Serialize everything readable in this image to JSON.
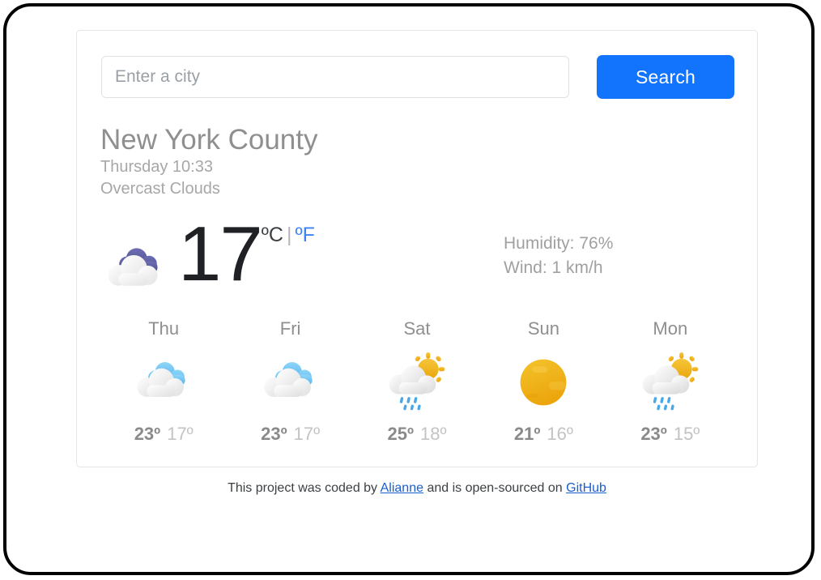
{
  "search": {
    "placeholder": "Enter a city",
    "value": "",
    "button_label": "Search"
  },
  "location": {
    "city": "New York County",
    "datetime": "Thursday 10:33",
    "condition": "Overcast Clouds"
  },
  "current": {
    "icon": "overcast-clouds-icon",
    "temperature": "17",
    "unit_celsius": "ºC",
    "unit_separator": "|",
    "unit_fahrenheit": "ºF",
    "humidity": "Humidity: 76%",
    "wind": "Wind: 1 km/h"
  },
  "forecast": [
    {
      "day": "Thu",
      "icon": "scattered-clouds-icon",
      "max": "23º",
      "min": "17º"
    },
    {
      "day": "Fri",
      "icon": "scattered-clouds-icon",
      "max": "23º",
      "min": "17º"
    },
    {
      "day": "Sat",
      "icon": "sun-cloud-rain-icon",
      "max": "25º",
      "min": "18º"
    },
    {
      "day": "Sun",
      "icon": "clear-sun-icon",
      "max": "21º",
      "min": "16º"
    },
    {
      "day": "Mon",
      "icon": "sun-cloud-rain-icon",
      "max": "23º",
      "min": "15º"
    }
  ],
  "footer": {
    "prefix": "This project was coded by ",
    "author_link": "Alianne",
    "middle": " and is open-sourced on ",
    "repo_link": "GitHub"
  },
  "colors": {
    "accent_blue": "#1273fc",
    "link_blue": "#1a5fd0",
    "unit_active_blue": "#3b82f6",
    "sun_gold": "#efb01e",
    "overcast_purple": "#5b5b9e",
    "cloud_blue": "#6ec6f5",
    "rain_blue": "#4aa8e8",
    "text_gray": "#8f8f8f"
  }
}
